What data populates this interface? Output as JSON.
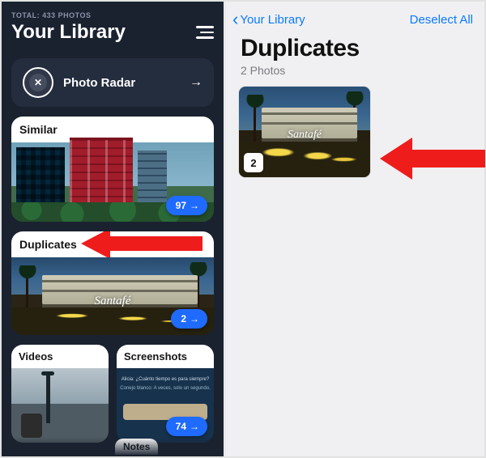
{
  "left": {
    "total_line": "TOTAL: 433 PHOTOS",
    "title": "Your Library",
    "radar": {
      "label": "Photo Radar",
      "close_glyph": "✕",
      "arrow_glyph": "→"
    },
    "cards": {
      "similar": {
        "title": "Similar",
        "count": "97",
        "arrow": "→"
      },
      "duplicates": {
        "title": "Duplicates",
        "count": "2",
        "arrow": "→",
        "sign": "Santafé"
      },
      "videos": {
        "title": "Videos"
      },
      "screenshots": {
        "title": "Screenshots",
        "count": "74",
        "arrow": "→",
        "line1": "Alicia: ¿Cuánto tiempo es para siempre?",
        "line2": "Conejo blanco: A veces, solo un segundo."
      },
      "notes_peek": "Notes"
    }
  },
  "right": {
    "back_label": "Your Library",
    "deselect_label": "Deselect All",
    "title": "Duplicates",
    "subtitle": "2 Photos",
    "thumb": {
      "badge": "2",
      "sign": "Santafé"
    }
  }
}
